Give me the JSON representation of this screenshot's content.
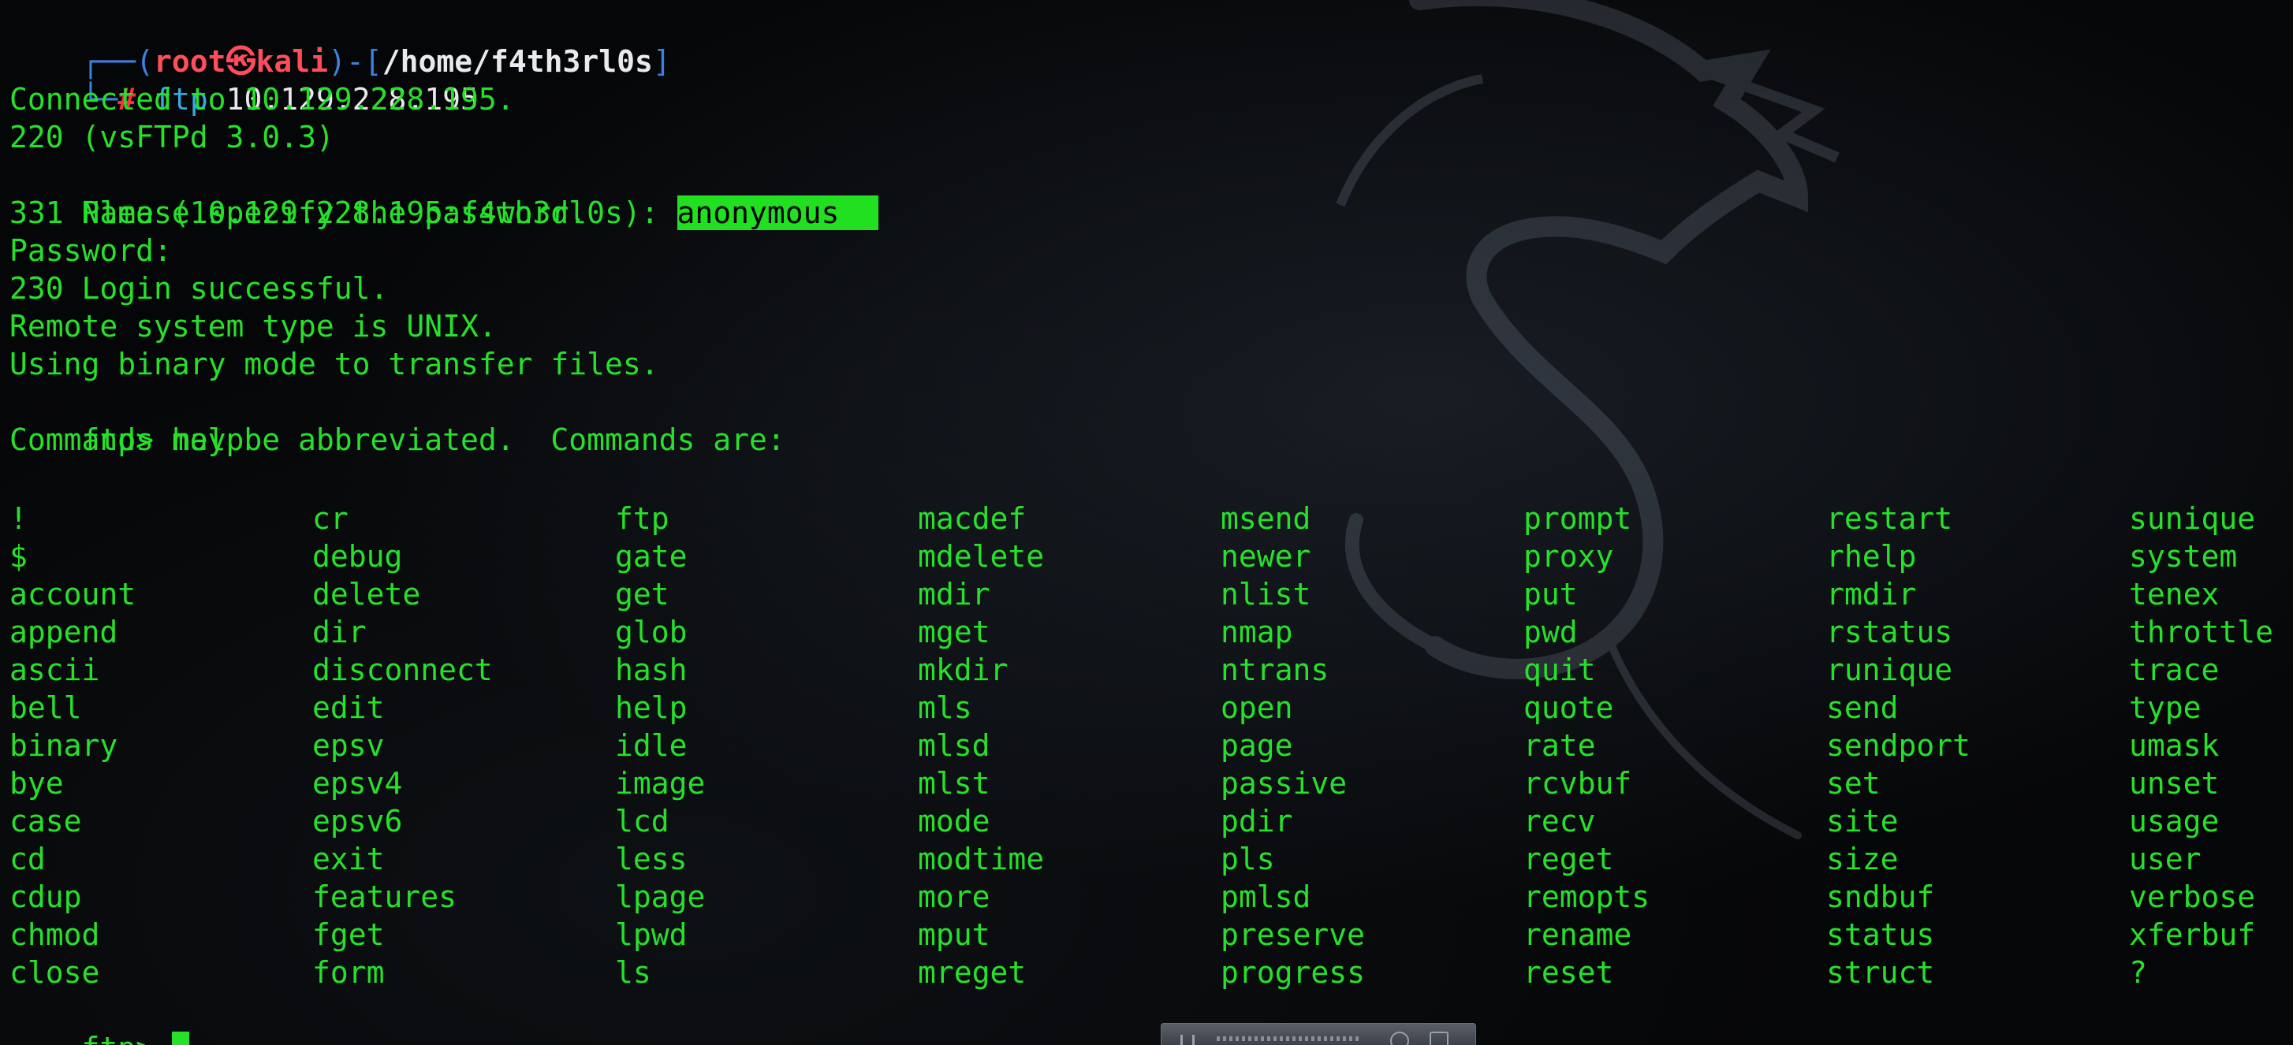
{
  "prompt": {
    "frame_open": "┌──(",
    "user_host": "root㉿kali",
    "frame_mid": ")-[",
    "path": "/home/f4th3rl0s",
    "frame_close": "]",
    "second_line_prefix": "└─",
    "hash": "#"
  },
  "session": {
    "command": "ftp",
    "command_arg": "10.129.228.195",
    "connected": "Connected to 10.129.228.195.",
    "banner": "220 (vsFTPd 3.0.3)",
    "name_prompt": "Name (10.129.228.195:f4th3rl0s): ",
    "name_input": "anonymous",
    "password_msg": "331 Please specify the password.",
    "password_prompt": "Password:",
    "login_msg": "230 Login successful.",
    "system_type": "Remote system type is UNIX.",
    "binary_mode": "Using binary mode to transfer files.",
    "ftp_prompt": "ftp> ",
    "help_cmd": "help",
    "commands_header": "Commands may be abbreviated.  Commands are:",
    "final_prompt": "ftp> "
  },
  "commands": {
    "col1": [
      "!",
      "$",
      "account",
      "append",
      "ascii",
      "bell",
      "binary",
      "bye",
      "case",
      "cd",
      "cdup",
      "chmod",
      "close"
    ],
    "col2": [
      "cr",
      "debug",
      "delete",
      "dir",
      "disconnect",
      "edit",
      "epsv",
      "epsv4",
      "epsv6",
      "exit",
      "features",
      "fget",
      "form"
    ],
    "col3": [
      "ftp",
      "gate",
      "get",
      "glob",
      "hash",
      "help",
      "idle",
      "image",
      "lcd",
      "less",
      "lpage",
      "lpwd",
      "ls"
    ],
    "col4": [
      "macdef",
      "mdelete",
      "mdir",
      "mget",
      "mkdir",
      "mls",
      "mlsd",
      "mlst",
      "mode",
      "modtime",
      "more",
      "mput",
      "mreget"
    ],
    "col5": [
      "msend",
      "newer",
      "nlist",
      "nmap",
      "ntrans",
      "open",
      "page",
      "passive",
      "pdir",
      "pls",
      "pmlsd",
      "preserve",
      "progress"
    ],
    "col6": [
      "prompt",
      "proxy",
      "put",
      "pwd",
      "quit",
      "quote",
      "rate",
      "rcvbuf",
      "recv",
      "reget",
      "remopts",
      "rename",
      "reset"
    ],
    "col7": [
      "restart",
      "rhelp",
      "rmdir",
      "rstatus",
      "runique",
      "send",
      "sendport",
      "set",
      "site",
      "size",
      "sndbuf",
      "status",
      "struct"
    ],
    "col8": [
      "sunique",
      "system",
      "tenex",
      "throttle",
      "trace",
      "type",
      "umask",
      "unset",
      "usage",
      "user",
      "verbose",
      "xferbuf",
      "?"
    ]
  },
  "colors": {
    "text_green": "#26e02a",
    "prompt_blue": "#3b82e0",
    "user_red": "#ff4d5a",
    "highlight_green": "#20e020",
    "background": "#050607"
  }
}
